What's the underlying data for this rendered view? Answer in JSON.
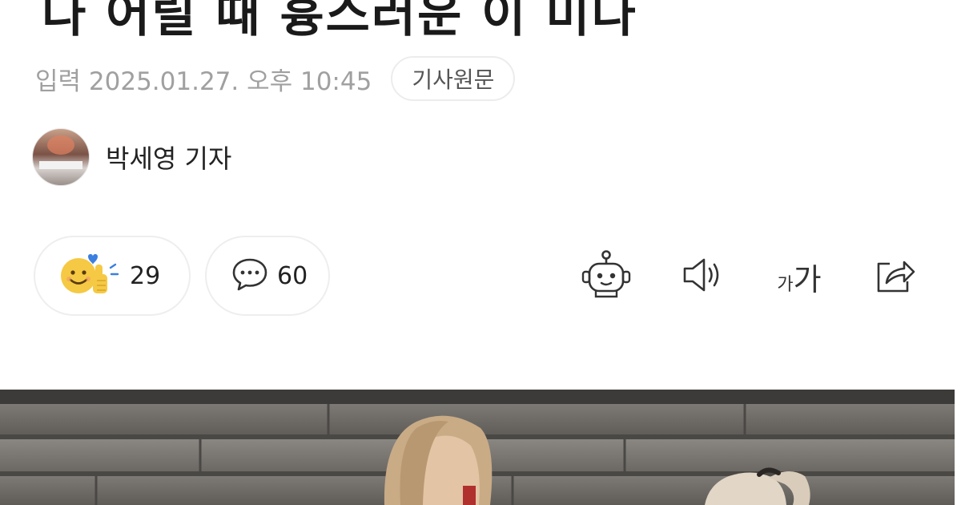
{
  "article": {
    "headline": "다 어릴 때 흉스러운 이 미다",
    "date": "입력 2025.01.27. 오후 10:45",
    "original_article_label": "기사원문",
    "reporter_name": "박세영 기자"
  },
  "actions": {
    "reaction_count": "29",
    "comment_count": "60"
  },
  "toolbar": {
    "font_small_label": "가",
    "font_large_label": "가"
  },
  "colors": {
    "date_text": "#a0a0a0",
    "emoji_yellow": "#f6c944",
    "heart_blue": "#3b7fe0"
  },
  "icons": [
    "smile-thumbs-reaction-icon",
    "speech-bubble-icon",
    "robot-icon",
    "speaker-icon",
    "font-size-icon",
    "share-icon"
  ]
}
